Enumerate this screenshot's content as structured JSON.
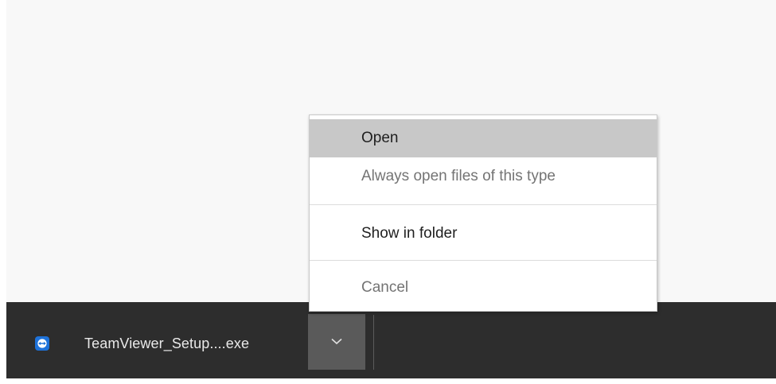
{
  "download_bar": {
    "item": {
      "file_name": "TeamViewer_Setup....exe",
      "icon": "teamviewer-icon"
    },
    "dropdown_icon": "chevron-down-icon"
  },
  "context_menu": {
    "items": [
      {
        "label": "Open",
        "state": "highlighted"
      },
      {
        "label": "Always open files of this type",
        "state": "disabled"
      },
      {
        "label": "Show in folder",
        "state": "enabled"
      },
      {
        "label": "Cancel",
        "state": "disabled"
      }
    ]
  },
  "colors": {
    "download_bar_bg": "#2d2d2d",
    "menu_highlight": "#c8c8c8",
    "teamviewer_blue": "#1e72d9"
  }
}
